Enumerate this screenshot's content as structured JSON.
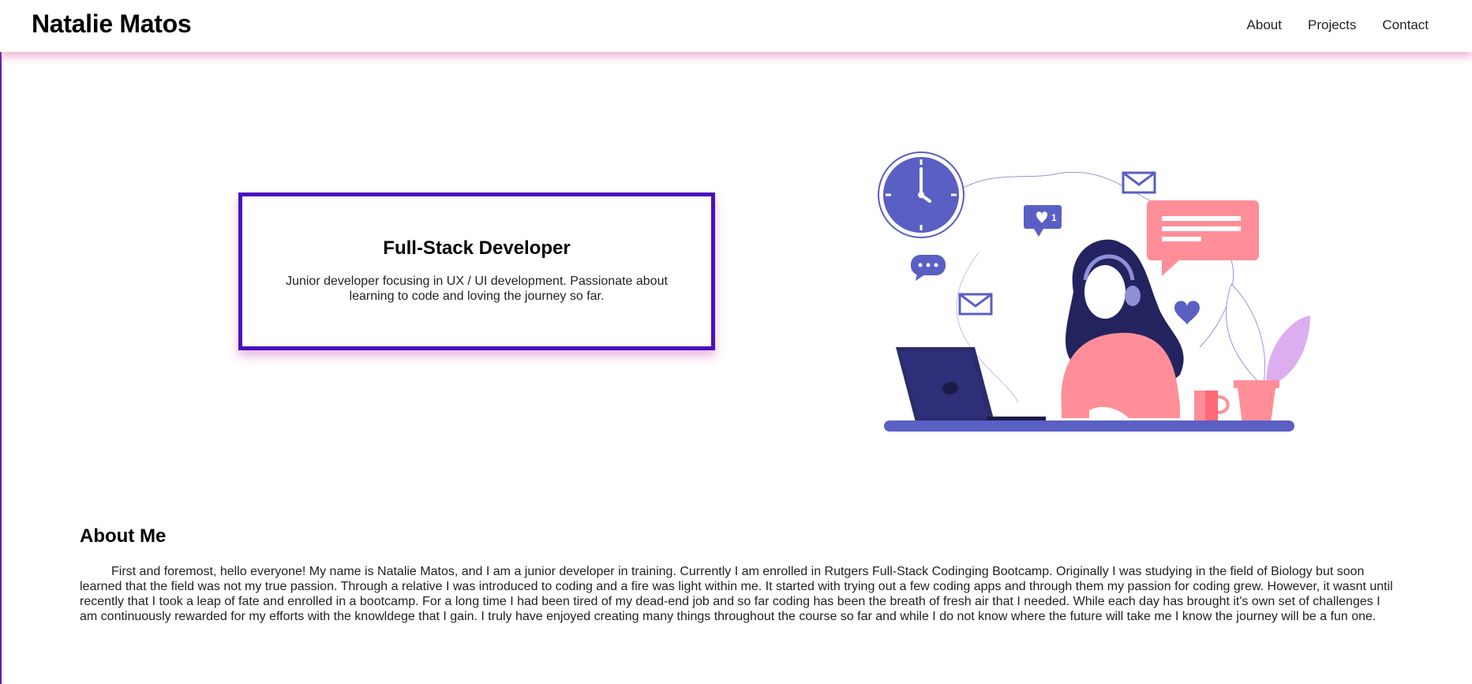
{
  "header": {
    "brand": "Natalie Matos",
    "nav": {
      "about": "About",
      "projects": "Projects",
      "contact": "Contact"
    }
  },
  "hero": {
    "title": "Full-Stack Developer",
    "subtitle": "Junior developer focusing in UX / UI development. Passionate about learning to code and loving the journey so far.",
    "illustration_like_count": "1"
  },
  "about": {
    "title": "About Me",
    "body": "First and foremost, hello everyone! My name is Natalie Matos, and I am a junior developer in training. Currently I am enrolled in Rutgers Full-Stack Codinging Bootcamp. Originally I was studying in the field of Biology but soon learned that the field was not my true passion. Through a relative I was introduced to coding and a fire was light within me. It started with trying out a few coding apps and through them my passion for coding grew. However, it wasnt until recently that I took a leap of fate and enrolled in a bootcamp. For a long time I had been tired of my dead-end job and so far coding has been the breath of fresh air that I needed. While each day has brought it's own set of challenges I am continuously rewarded for my efforts with the knowldege that I gain. I truly have enjoyed creating many things throughout the course so far and while I do not know where the future will take me I know the journey will be a fun one."
  },
  "colors": {
    "accent_border": "#4a10bf",
    "shadow_pink": "#dc5a96",
    "illus_navy": "#2b2c6b",
    "illus_periwinkle": "#5a5fc4",
    "illus_pink": "#ff8e98",
    "illus_lilac": "#dcaef0"
  }
}
